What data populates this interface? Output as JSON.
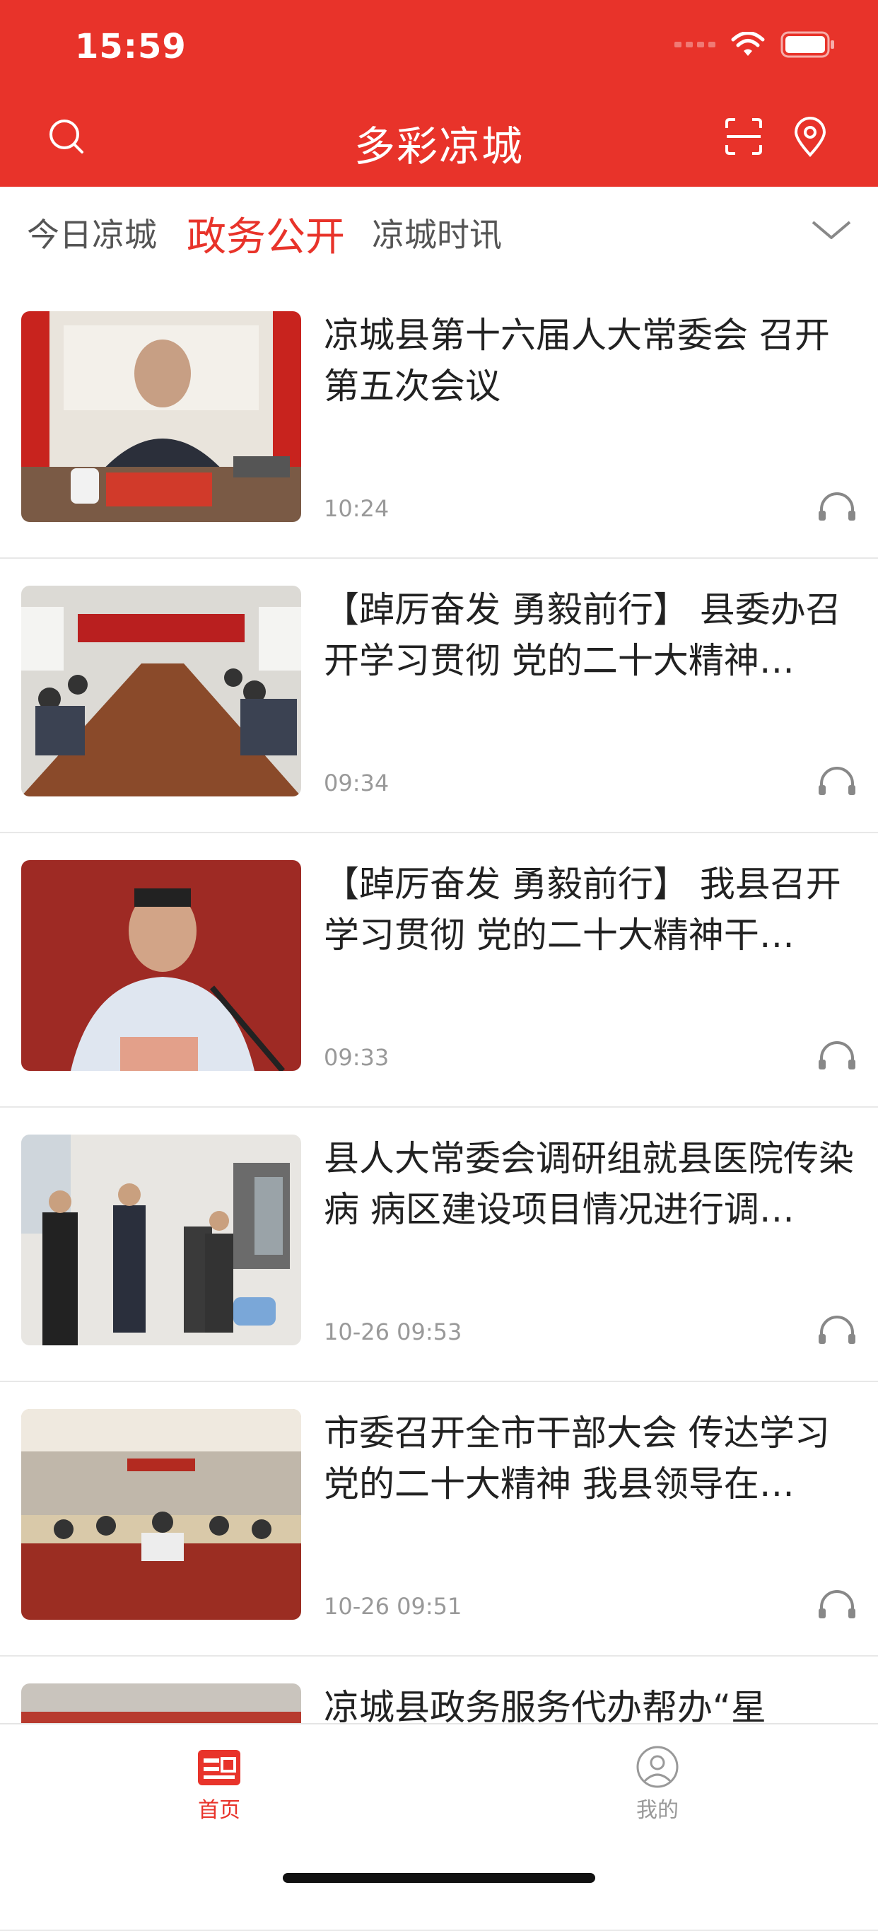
{
  "status": {
    "time": "15:59"
  },
  "header": {
    "title": "多彩凉城",
    "bg_color": "#e8332a",
    "icons": [
      "search-icon",
      "scan-icon",
      "location-icon"
    ]
  },
  "tabs": [
    {
      "label": "今日凉城",
      "active": false
    },
    {
      "label": "政务公开",
      "active": true
    },
    {
      "label": "凉城时讯",
      "active": false
    }
  ],
  "feed": [
    {
      "title": "凉城县第十六届人大常委会 召开第五次会议",
      "time": "10:24"
    },
    {
      "title": "【踔厉奋发 勇毅前行】 县委办召开学习贯彻 党的二十大精神…",
      "time": "09:34"
    },
    {
      "title": "【踔厉奋发 勇毅前行】 我县召开学习贯彻 党的二十大精神干…",
      "time": "09:33"
    },
    {
      "title": "县人大常委会调研组就县医院传染病 病区建设项目情况进行调…",
      "time": "10-26 09:53"
    },
    {
      "title": "市委召开全市干部大会 传达学习党的二十大精神 我县领导在…",
      "time": "10-26 09:51"
    },
    {
      "title": "凉城县政务服务代办帮办“星",
      "time": ""
    }
  ],
  "bottom_nav": [
    {
      "label": "首页",
      "active": true
    },
    {
      "label": "我的",
      "active": false
    }
  ]
}
